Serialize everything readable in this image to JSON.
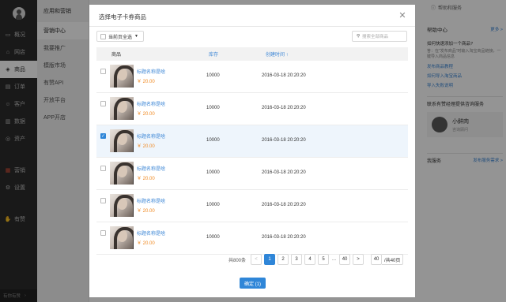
{
  "sidebar": {
    "items": [
      {
        "label": "概况",
        "icon": "monitor-icon"
      },
      {
        "label": "网店",
        "icon": "store-icon"
      },
      {
        "label": "商品",
        "icon": "tag-icon",
        "active": true
      },
      {
        "label": "订单",
        "icon": "order-icon"
      },
      {
        "label": "客户",
        "icon": "user-icon"
      },
      {
        "label": "数据",
        "icon": "chart-icon"
      },
      {
        "label": "资产",
        "icon": "coin-icon"
      },
      {
        "label": "营销",
        "icon": "grid-icon"
      },
      {
        "label": "设置",
        "icon": "gear-icon"
      },
      {
        "label": "有赞",
        "icon": "thumb-icon"
      }
    ],
    "bottom_label": "有你有赞"
  },
  "subnav": {
    "title": "应用和营销",
    "items": [
      "营销中心",
      "我要推广",
      "模版市场",
      "有赞API",
      "开放平台",
      "APP开店"
    ]
  },
  "top_help": "帮助和服务",
  "right_panel": {
    "help_title": "帮助中心",
    "more": "更多 >",
    "question": "如何快速添加一个商品?",
    "desc": "答：在\"发布商品\"时输入淘宝商品链接，一键导入商品信息",
    "links": [
      "发布商品教程",
      "如何导入淘宝商品",
      "导入失败说明"
    ],
    "service_title": "联系有赞经理提供咨询服务",
    "manager_name": "小鲜肉",
    "manager_role": "咨询顾问",
    "my_service": "我服务",
    "publish_request": "发布服务需求 >"
  },
  "modal": {
    "title": "选择电子卡券商品",
    "close_icon": "close-icon",
    "select_all": "当前页全选",
    "search_placeholder": "搜索全部商品",
    "columns": {
      "goods": "商品",
      "stock": "库存",
      "created": "创建时间 ↑"
    },
    "rows": [
      {
        "name": "标题名称是啥",
        "price": "￥ 20.00",
        "stock": "10000",
        "created": "2016-03-18 20:20:20",
        "checked": false
      },
      {
        "name": "标题名称是啥",
        "price": "￥ 20.00",
        "stock": "10000",
        "created": "2016-03-18 20:20:20",
        "checked": false
      },
      {
        "name": "标题名称是啥",
        "price": "￥ 20.00",
        "stock": "10000",
        "created": "2016-03-18 20:20:20",
        "checked": true
      },
      {
        "name": "标题名称是啥",
        "price": "￥ 20.00",
        "stock": "10000",
        "created": "2016-03-18 20:20:20",
        "checked": false
      },
      {
        "name": "标题名称是啥",
        "price": "￥ 20.00",
        "stock": "10000",
        "created": "2016-03-18 20:20:20",
        "checked": false
      },
      {
        "name": "标题名称是啥",
        "price": "￥ 20.00",
        "stock": "10000",
        "created": "2016-03-18 20:20:20",
        "checked": false
      }
    ],
    "pagination": {
      "total": "共800条",
      "prev": "<",
      "pages": [
        "1",
        "2",
        "3",
        "4",
        "5"
      ],
      "current": "1",
      "dots": "...",
      "last": "40",
      "next": ">",
      "jump_value": "40",
      "jump_total": "/共40页"
    },
    "confirm": "确定 (1)"
  },
  "colors": {
    "accent": "#2f86d8",
    "price": "#f08a24",
    "sidebar": "#2b2b2b"
  }
}
